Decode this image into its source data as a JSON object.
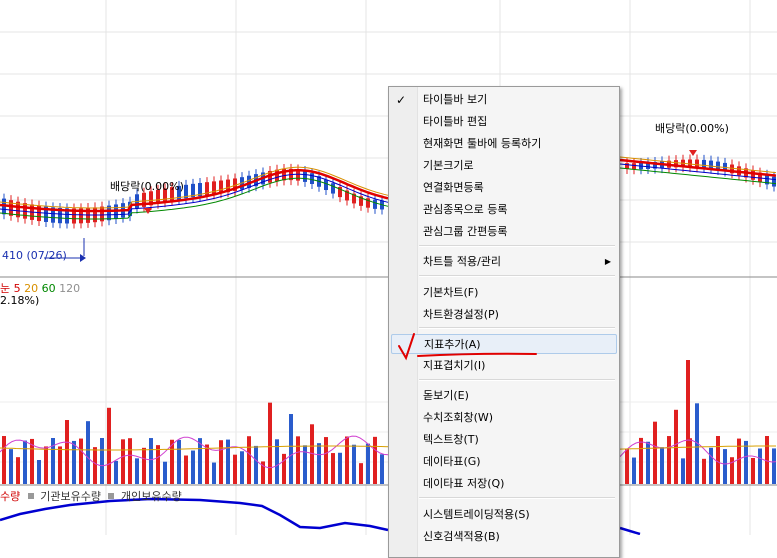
{
  "chart": {
    "div_label_1": "배당락(0.00%)",
    "div_label_2": "배당락(0.00%)",
    "low_marker": "410 (07/26)",
    "ma_legend_prefix": "눈",
    "ma_periods": [
      "5",
      "20",
      "60",
      "120"
    ],
    "ma_colors": [
      "#d00000",
      "#d89000",
      "#008800",
      "#0000c8",
      "#909090"
    ],
    "percent_text": "2.18%)",
    "series_legend": [
      "수량",
      "기관보유수량",
      "개인보유수량"
    ],
    "colors": {
      "up": "#e02020",
      "down": "#2050c8",
      "ma_red": "#e00000",
      "line_blue": "#0000d0"
    }
  },
  "context_menu": {
    "check_glyph": "✓",
    "submenu_glyph": "▶",
    "items": [
      {
        "label": "타이틀바 보기",
        "checked": true
      },
      {
        "label": "타이틀바 편집"
      },
      {
        "label": "현재화면 툴바에 등록하기"
      },
      {
        "label": "기본크기로"
      },
      {
        "label": "연결화면등록"
      },
      {
        "label": "관심종목으로 등록"
      },
      {
        "label": "관심그룹 간편등록"
      },
      {
        "label": "차트틀 적용/관리",
        "submenu": true
      },
      {
        "label": "기본차트(F)"
      },
      {
        "label": "차트환경설정(P)"
      },
      {
        "label": "지표추가(A)",
        "highlighted": true
      },
      {
        "label": "지표겹치기(I)"
      },
      {
        "label": "돋보기(E)"
      },
      {
        "label": "수치조회창(W)"
      },
      {
        "label": "텍스트창(T)"
      },
      {
        "label": "데이타표(G)"
      },
      {
        "label": "데이타표 저장(Q)"
      },
      {
        "label": "시스템트레이딩적용(S)"
      },
      {
        "label": "신호검색적용(B)"
      }
    ]
  }
}
